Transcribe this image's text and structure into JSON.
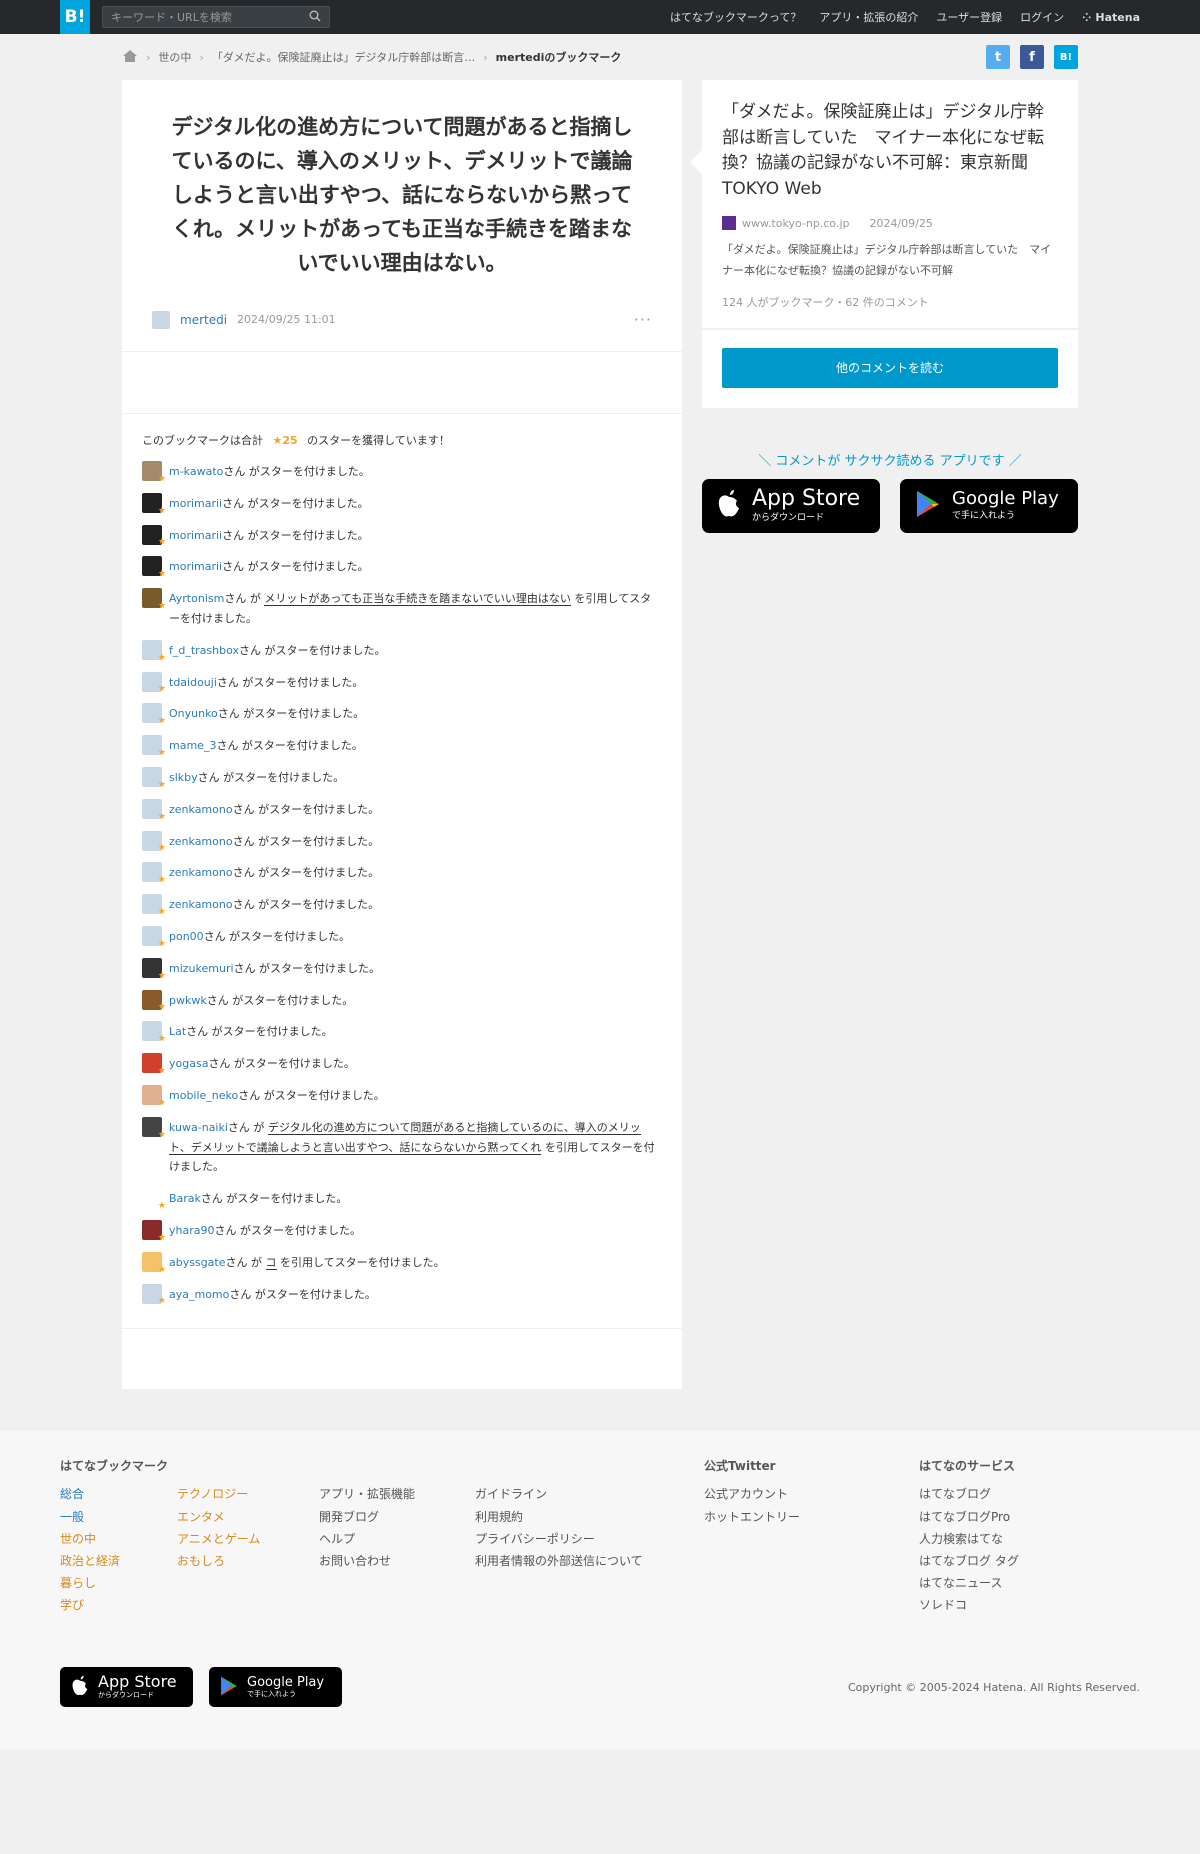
{
  "header": {
    "logo": "B!",
    "search_placeholder": "キーワード・URLを検索",
    "links": [
      "はてなブックマークって？",
      "アプリ・拡張の紹介",
      "ユーザー登録",
      "ログイン"
    ],
    "brand": "Hatena"
  },
  "breadcrumb": {
    "items": [
      "世の中",
      "「ダメだよ。保険証廃止は」デジタル庁幹部は断言…"
    ],
    "current": "mertediのブックマーク"
  },
  "share": {
    "twitter": "t",
    "facebook": "f",
    "hatena": "B!"
  },
  "comment": {
    "text": "デジタル化の進め方について問題があると指摘しているのに、導入のメリット、デメリットで議論しようと言い出すやつ、話にならないから黙ってくれ。メリットがあっても正当な手続きを踏まないでいい理由はない。",
    "user": "mertedi",
    "date": "2024/09/25 11:01",
    "more": "···"
  },
  "stars": {
    "summary_prefix": "このブックマークは合計",
    "count": "★25",
    "summary_suffix": "のスターを獲得しています！",
    "rows": [
      {
        "user": "m-kawato",
        "pre": "さん がスターを付けました。",
        "quote": "",
        "post": "",
        "color": "#a58a6a"
      },
      {
        "user": "morimarii",
        "pre": "さん がスターを付けました。",
        "quote": "",
        "post": "",
        "color": "#222"
      },
      {
        "user": "morimarii",
        "pre": "さん がスターを付けました。",
        "quote": "",
        "post": "",
        "color": "#222"
      },
      {
        "user": "morimarii",
        "pre": "さん がスターを付けました。",
        "quote": "",
        "post": "",
        "color": "#222"
      },
      {
        "user": "Ayrtonism",
        "pre": "さん が ",
        "quote": "メリットがあっても正当な手続きを踏まないでいい理由はない",
        "post": " を引用してスターを付けました。",
        "color": "#7a5a2a"
      },
      {
        "user": "f_d_trashbox",
        "pre": "さん がスターを付けました。",
        "quote": "",
        "post": "",
        "color": "#c9d6e3"
      },
      {
        "user": "tdaidouji",
        "pre": "さん がスターを付けました。",
        "quote": "",
        "post": "",
        "color": "#c9d6e3"
      },
      {
        "user": "Onyunko",
        "pre": "さん がスターを付けました。",
        "quote": "",
        "post": "",
        "color": "#c9d6e3"
      },
      {
        "user": "mame_3",
        "pre": "さん がスターを付けました。",
        "quote": "",
        "post": "",
        "color": "#c9d6e3"
      },
      {
        "user": "slkby",
        "pre": "さん がスターを付けました。",
        "quote": "",
        "post": "",
        "color": "#c9d6e3"
      },
      {
        "user": "zenkamono",
        "pre": "さん がスターを付けました。",
        "quote": "",
        "post": "",
        "color": "#c9d6e3"
      },
      {
        "user": "zenkamono",
        "pre": "さん がスターを付けました。",
        "quote": "",
        "post": "",
        "color": "#c9d6e3"
      },
      {
        "user": "zenkamono",
        "pre": "さん がスターを付けました。",
        "quote": "",
        "post": "",
        "color": "#c9d6e3"
      },
      {
        "user": "zenkamono",
        "pre": "さん がスターを付けました。",
        "quote": "",
        "post": "",
        "color": "#c9d6e3"
      },
      {
        "user": "pon00",
        "pre": "さん がスターを付けました。",
        "quote": "",
        "post": "",
        "color": "#c9d6e3"
      },
      {
        "user": "mizukemuri",
        "pre": "さん がスターを付けました。",
        "quote": "",
        "post": "",
        "color": "#333"
      },
      {
        "user": "pwkwk",
        "pre": "さん がスターを付けました。",
        "quote": "",
        "post": "",
        "color": "#8a5a2a"
      },
      {
        "user": "Lat",
        "pre": "さん がスターを付けました。",
        "quote": "",
        "post": "",
        "color": "#c9d6e3"
      },
      {
        "user": "yogasa",
        "pre": "さん がスターを付けました。",
        "quote": "",
        "post": "",
        "color": "#d0402a"
      },
      {
        "user": "mobile_neko",
        "pre": "さん がスターを付けました。",
        "quote": "",
        "post": "",
        "color": "#e0b090"
      },
      {
        "user": "kuwa-naiki",
        "pre": "さん が ",
        "quote": "デジタル化の進め方について問題があると指摘しているのに、導入のメリット、デメリットで議論しようと言い出すやつ、話にならないから黙ってくれ",
        "post": " を引用してスターを付けました。",
        "color": "#444"
      },
      {
        "user": "Barak",
        "pre": "さん がスターを付けました。",
        "quote": "",
        "post": "",
        "color": "#fff"
      },
      {
        "user": "yhara90",
        "pre": "さん がスターを付けました。",
        "quote": "",
        "post": "",
        "color": "#8a2a2a"
      },
      {
        "user": "abyssgate",
        "pre": "さん が ",
        "quote": "コ",
        "post": " を引用してスターを付けました。",
        "color": "#f5c26a"
      },
      {
        "user": "aya_momo",
        "pre": "さん がスターを付けました。",
        "quote": "",
        "post": "",
        "color": "#c9d6e3"
      }
    ]
  },
  "entry": {
    "title": "「ダメだよ。保険証廃止は」デジタル庁幹部は断言していた　マイナー本化になぜ転換？協議の記録がない不可解：東京新聞 TOKYO Web",
    "domain": "www.tokyo-np.co.jp",
    "date": "2024/09/25",
    "description": "「ダメだよ。保険証廃止は」デジタル庁幹部は断言していた　マイナー本化になぜ転換？協議の記録がない不可解",
    "count": "124 人がブックマーク・62 件のコメント",
    "cta": "他のコメントを読む"
  },
  "promo": {
    "text": "＼ コメントが サクサク読める アプリです ／",
    "appstore_big": "App Store",
    "appstore_small": "からダウンロード",
    "googleplay_big": "Google Play",
    "googleplay_small": "で手に入れよう"
  },
  "footer": {
    "col1_title": "はてなブックマーク",
    "col1a": [
      "総合",
      "一般",
      "世の中",
      "政治と経済",
      "暮らし",
      "学び"
    ],
    "col1b": [
      "テクノロジー",
      "エンタメ",
      "アニメとゲーム",
      "おもしろ"
    ],
    "col1c": [
      "アプリ・拡張機能",
      "開発ブログ",
      "ヘルプ",
      "お問い合わせ"
    ],
    "col1d": [
      "ガイドライン",
      "利用規約",
      "プライバシーポリシー",
      "利用者情報の外部送信について"
    ],
    "col2_title": "公式Twitter",
    "col2": [
      "公式アカウント",
      "ホットエントリー"
    ],
    "col3_title": "はてなのサービス",
    "col3": [
      "はてなブログ",
      "はてなブログPro",
      "人力検索はてな",
      "はてなブログ タグ",
      "はてなニュース",
      "ソレドコ"
    ],
    "copyright": "Copyright © 2005-2024 Hatena. All Rights Reserved."
  }
}
